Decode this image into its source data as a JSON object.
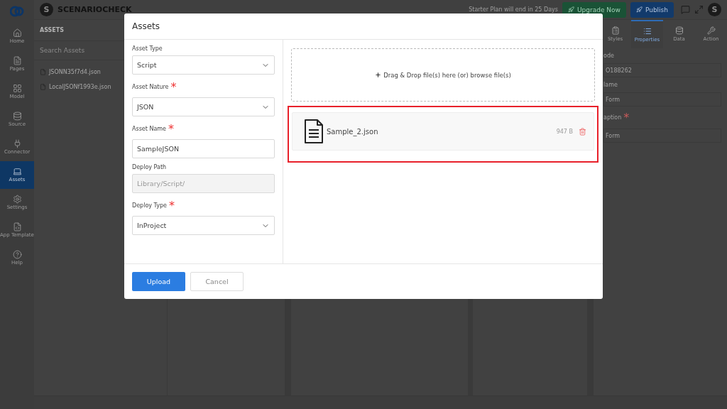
{
  "topbar": {
    "brand": "SCENARIOCHECK",
    "brand_initial": "S",
    "plan_notice": "Starter Plan will end in 25 Days",
    "upgrade": "Upgrade Now",
    "publish": "Publish",
    "user_initial": "S"
  },
  "rail": [
    {
      "label": "Home",
      "selected": false
    },
    {
      "label": "Pages",
      "selected": false
    },
    {
      "label": "Model",
      "selected": false
    },
    {
      "label": "Source",
      "selected": false
    },
    {
      "label": "Connector",
      "selected": false
    },
    {
      "label": "Assets",
      "selected": true
    },
    {
      "label": "Settings",
      "selected": false
    },
    {
      "label": "App Template",
      "selected": false
    },
    {
      "label": "Help",
      "selected": false
    }
  ],
  "assets_panel": {
    "title": "ASSETS",
    "search_placeholder": "Search Assets",
    "files": [
      "JSONN35f7d4.json",
      "LocalJSONf1993e.json"
    ]
  },
  "right_panel": {
    "tabs": [
      {
        "label": "Styles",
        "selected": false
      },
      {
        "label": "Properties",
        "selected": true
      },
      {
        "label": "Data",
        "selected": false
      },
      {
        "label": "Action",
        "selected": false
      }
    ],
    "fields": [
      {
        "label": "ode",
        "value": "O188262"
      },
      {
        "label": "lame",
        "value": "Form"
      },
      {
        "label": "aption",
        "required_mark": "*",
        "value": "Form"
      }
    ]
  },
  "modal": {
    "title": "Assets",
    "fields": [
      {
        "kind": "select",
        "label": "Asset Type",
        "value": "Script"
      },
      {
        "kind": "select",
        "label": "Asset Nature",
        "required_mark": "*",
        "value": "JSON"
      },
      {
        "kind": "text",
        "label": "Asset Name",
        "required_mark": "*",
        "value": "SampleJSON"
      },
      {
        "kind": "readonly",
        "label": "Deploy Path",
        "value": "Library/Script/"
      },
      {
        "kind": "select",
        "label": "Deploy Type",
        "required_mark": "*",
        "value": "InProject"
      }
    ],
    "dropzone": "Drag & Drop file(s) here (or) browse file(s)",
    "uploaded": [
      {
        "name": "Sample_2.json",
        "size": "947 B"
      }
    ],
    "highlighted": true,
    "buttons": [
      {
        "label": "Upload",
        "kind": "primary"
      },
      {
        "label": "Cancel",
        "kind": "secondary"
      }
    ]
  }
}
